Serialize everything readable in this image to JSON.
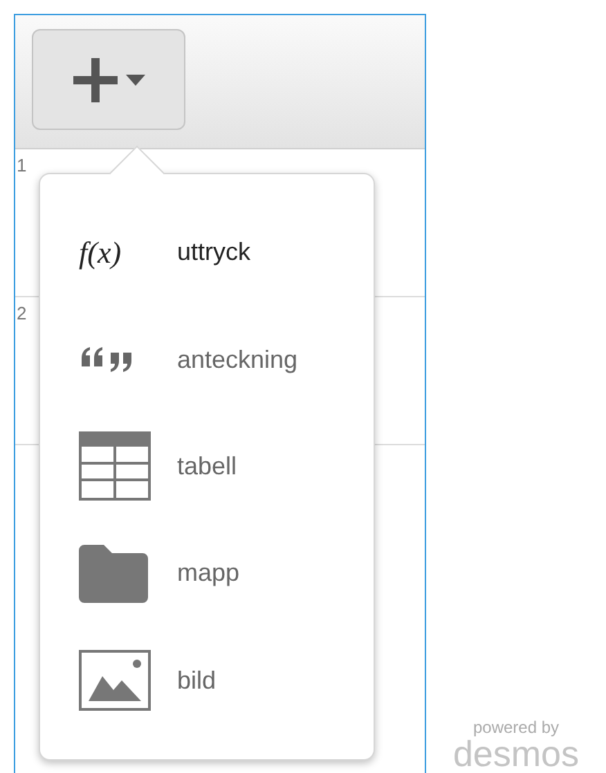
{
  "toolbar": {
    "add_button": {
      "expanded": true
    }
  },
  "rows": [
    {
      "number": "1"
    },
    {
      "number": "2"
    }
  ],
  "add_menu": {
    "items": [
      {
        "kind": "expression",
        "icon_text": "f(x)",
        "label": "uttryck"
      },
      {
        "kind": "note",
        "label": "anteckning"
      },
      {
        "kind": "table",
        "label": "tabell"
      },
      {
        "kind": "folder",
        "label": "mapp"
      },
      {
        "kind": "image",
        "label": "bild"
      }
    ]
  },
  "branding": {
    "caption": "powered by",
    "logo": "desmos"
  }
}
